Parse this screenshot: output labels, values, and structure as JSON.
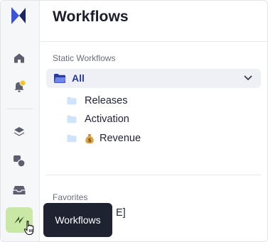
{
  "page": {
    "title": "Workflows"
  },
  "sections": {
    "static": {
      "label": "Static Workflows"
    },
    "favorites": {
      "label": "Favorites",
      "first_item_visible_text": "E]"
    }
  },
  "tree": {
    "root": {
      "label": "All",
      "expanded": true
    },
    "children": [
      {
        "label": "Releases"
      },
      {
        "label": "Activation"
      },
      {
        "label": "Revenue",
        "emoji": "money-bag"
      }
    ]
  },
  "rail": {
    "items": [
      {
        "name": "home",
        "icon": "home-icon"
      },
      {
        "name": "notifications",
        "icon": "bell-icon",
        "badge": true
      },
      {
        "name": "layers",
        "icon": "layers-icon"
      },
      {
        "name": "shapes",
        "icon": "shapes-icon"
      },
      {
        "name": "inbox",
        "icon": "inbox-icon"
      },
      {
        "name": "workflows",
        "icon": "bolt-icon",
        "active": true
      }
    ]
  },
  "tooltip": {
    "text": "Workflows"
  },
  "colors": {
    "accent": "#2b3a9f",
    "active_rail": "#c9e7a5",
    "folder": "#cfe3fb",
    "badge": "#f5c528"
  }
}
